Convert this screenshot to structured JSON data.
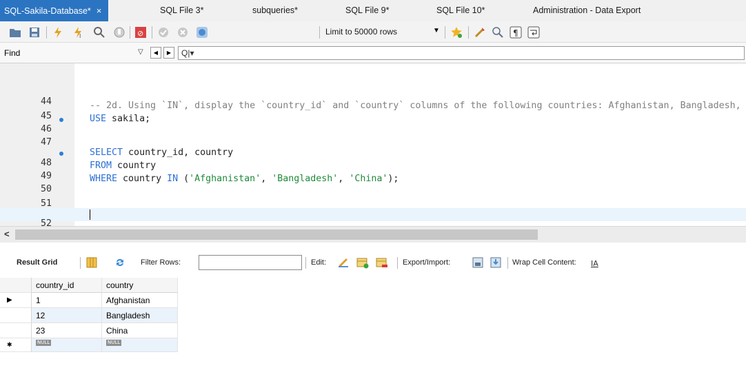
{
  "tabs": [
    {
      "label": "SQL-Sakila-Database*",
      "active": true
    },
    {
      "label": "SQL File 3*"
    },
    {
      "label": "subqueries*"
    },
    {
      "label": "SQL File 9*"
    },
    {
      "label": "SQL File 10*"
    },
    {
      "label": "Administration - Data Export"
    }
  ],
  "tab_close": "×",
  "toolbar": {
    "limit_select": "Limit to 50000 rows",
    "icons": [
      "open-folder-icon",
      "save-icon",
      "execute-icon",
      "execute-current-icon",
      "explain-icon",
      "stop-icon",
      "toggle-error-icon",
      "commit-icon",
      "rollback-icon",
      "autocommit-icon",
      "bookmark-star-icon",
      "beautify-icon",
      "find-replace-icon",
      "invisible-chars-icon",
      "wrap-icon"
    ]
  },
  "find": {
    "label": "Find",
    "prev": "◀",
    "next": "▶",
    "search_glyph": "Q|▾"
  },
  "editor": {
    "lines": [
      {
        "num": "44",
        "text": ""
      },
      {
        "num": "45",
        "text": "-- 2d. Using `IN`, display the `country_id` and `country` columns of the following countries: Afghanistan, Bangladesh, and China:"
      },
      {
        "num": "46",
        "dot": true
      },
      {
        "num": "47",
        "text": ""
      },
      {
        "num": "48",
        "dot": true
      },
      {
        "num": "49"
      },
      {
        "num": "50"
      },
      {
        "num": "51",
        "text": ""
      },
      {
        "num": "52",
        "text": ""
      }
    ],
    "tokens": {
      "use_kw": "USE",
      "use_rest": " sakila;",
      "select_kw": "SELECT",
      "select_rest": " country_id, country",
      "from_kw": "FROM",
      "from_rest": " country",
      "where_kw": "WHERE",
      "where_rest": " country ",
      "in_kw": "IN",
      "open": " (",
      "s1": "'Afghanistan'",
      "c1": ", ",
      "s2": "'Bangladesh'",
      "c2": ", ",
      "s3": "'China'",
      "close": ");"
    }
  },
  "scroll_arrow": "<",
  "result_toolbar": {
    "result_grid": "Result Grid",
    "filter_rows": "Filter Rows:",
    "edit": "Edit:",
    "export_import": "Export/Import:",
    "wrap": "Wrap Cell Content:"
  },
  "grid": {
    "columns": [
      "country_id",
      "country"
    ],
    "rows": [
      [
        "1",
        "Afghanistan"
      ],
      [
        "12",
        "Bangladesh"
      ],
      [
        "23",
        "China"
      ]
    ],
    "null_label": "NULL",
    "current_marker": "▶",
    "new_marker": "✱"
  }
}
